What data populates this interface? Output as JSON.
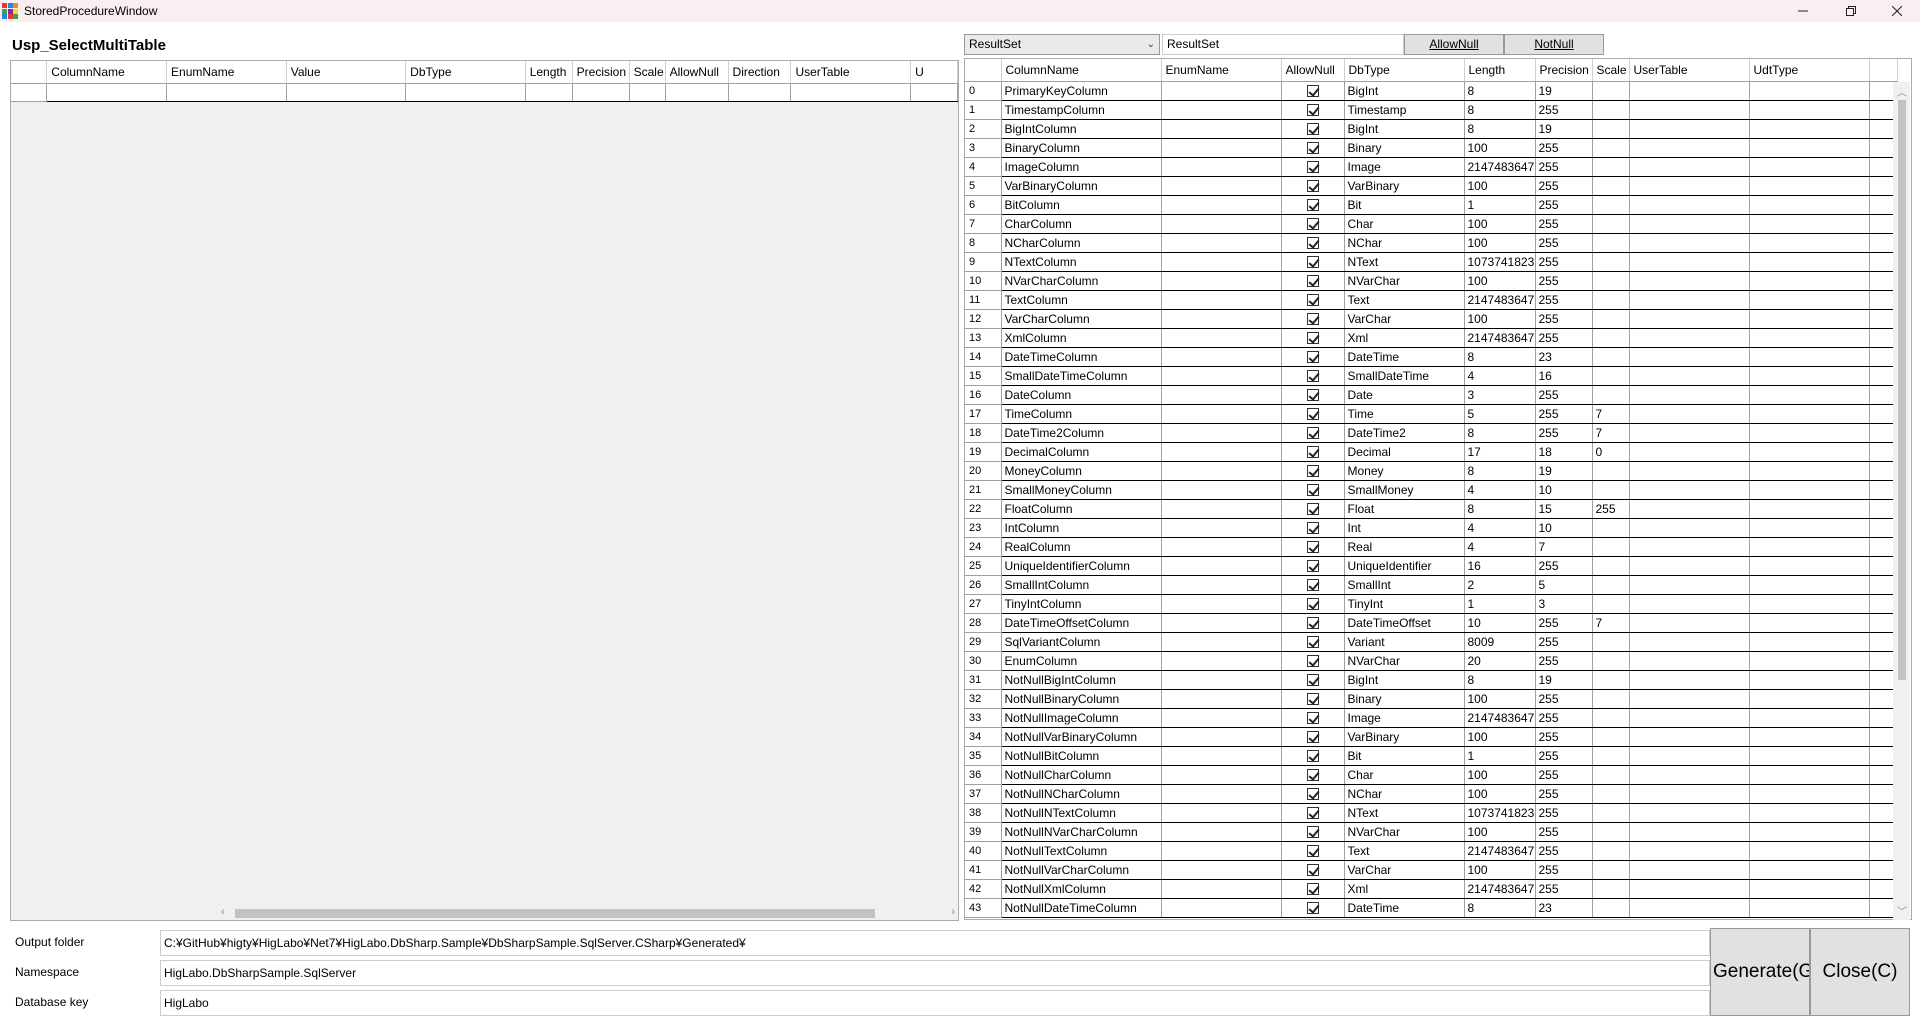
{
  "window": {
    "title": "StoredProcedureWindow",
    "icon": "app-grid-icon",
    "icon_colors": [
      "#e53935",
      "#1e88e5",
      "#fb8c00",
      "#43a047",
      "#8e24aa",
      "#fdd835",
      "#1e88e5",
      "#e53935",
      "#43a047"
    ]
  },
  "procedure_name": "Usp_SelectMultiTable",
  "parameters_grid": {
    "columns": [
      "ColumnName",
      "EnumName",
      "Value",
      "DbType",
      "Length",
      "Precision",
      "Scale",
      "AllowNull",
      "Direction",
      "UserTable",
      "U"
    ],
    "rows": []
  },
  "resultset": {
    "selected": "ResultSet",
    "name": "ResultSet",
    "allow_null_label": "AllowNull",
    "not_null_label": "NotNull"
  },
  "result_grid": {
    "columns": [
      "ColumnName",
      "EnumName",
      "AllowNull",
      "DbType",
      "Length",
      "Precision",
      "Scale",
      "UserTable",
      "UdtType"
    ],
    "rows": [
      {
        "i": "0",
        "name": "PrimaryKeyColumn",
        "type": "BigInt",
        "len": "8",
        "prec": "19",
        "scale": ""
      },
      {
        "i": "1",
        "name": "TimestampColumn",
        "type": "Timestamp",
        "len": "8",
        "prec": "255",
        "scale": ""
      },
      {
        "i": "2",
        "name": "BigIntColumn",
        "type": "BigInt",
        "len": "8",
        "prec": "19",
        "scale": ""
      },
      {
        "i": "3",
        "name": "BinaryColumn",
        "type": "Binary",
        "len": "100",
        "prec": "255",
        "scale": ""
      },
      {
        "i": "4",
        "name": "ImageColumn",
        "type": "Image",
        "len": "2147483647",
        "prec": "255",
        "scale": ""
      },
      {
        "i": "5",
        "name": "VarBinaryColumn",
        "type": "VarBinary",
        "len": "100",
        "prec": "255",
        "scale": ""
      },
      {
        "i": "6",
        "name": "BitColumn",
        "type": "Bit",
        "len": "1",
        "prec": "255",
        "scale": ""
      },
      {
        "i": "7",
        "name": "CharColumn",
        "type": "Char",
        "len": "100",
        "prec": "255",
        "scale": ""
      },
      {
        "i": "8",
        "name": "NCharColumn",
        "type": "NChar",
        "len": "100",
        "prec": "255",
        "scale": ""
      },
      {
        "i": "9",
        "name": "NTextColumn",
        "type": "NText",
        "len": "1073741823",
        "prec": "255",
        "scale": ""
      },
      {
        "i": "10",
        "name": "NVarCharColumn",
        "type": "NVarChar",
        "len": "100",
        "prec": "255",
        "scale": ""
      },
      {
        "i": "11",
        "name": "TextColumn",
        "type": "Text",
        "len": "2147483647",
        "prec": "255",
        "scale": ""
      },
      {
        "i": "12",
        "name": "VarCharColumn",
        "type": "VarChar",
        "len": "100",
        "prec": "255",
        "scale": ""
      },
      {
        "i": "13",
        "name": "XmlColumn",
        "type": "Xml",
        "len": "2147483647",
        "prec": "255",
        "scale": ""
      },
      {
        "i": "14",
        "name": "DateTimeColumn",
        "type": "DateTime",
        "len": "8",
        "prec": "23",
        "scale": ""
      },
      {
        "i": "15",
        "name": "SmallDateTimeColumn",
        "type": "SmallDateTime",
        "len": "4",
        "prec": "16",
        "scale": ""
      },
      {
        "i": "16",
        "name": "DateColumn",
        "type": "Date",
        "len": "3",
        "prec": "255",
        "scale": ""
      },
      {
        "i": "17",
        "name": "TimeColumn",
        "type": "Time",
        "len": "5",
        "prec": "255",
        "scale": "7"
      },
      {
        "i": "18",
        "name": "DateTime2Column",
        "type": "DateTime2",
        "len": "8",
        "prec": "255",
        "scale": "7"
      },
      {
        "i": "19",
        "name": "DecimalColumn",
        "type": "Decimal",
        "len": "17",
        "prec": "18",
        "scale": "0"
      },
      {
        "i": "20",
        "name": "MoneyColumn",
        "type": "Money",
        "len": "8",
        "prec": "19",
        "scale": ""
      },
      {
        "i": "21",
        "name": "SmallMoneyColumn",
        "type": "SmallMoney",
        "len": "4",
        "prec": "10",
        "scale": ""
      },
      {
        "i": "22",
        "name": "FloatColumn",
        "type": "Float",
        "len": "8",
        "prec": "15",
        "scale": "255"
      },
      {
        "i": "23",
        "name": "IntColumn",
        "type": "Int",
        "len": "4",
        "prec": "10",
        "scale": ""
      },
      {
        "i": "24",
        "name": "RealColumn",
        "type": "Real",
        "len": "4",
        "prec": "7",
        "scale": ""
      },
      {
        "i": "25",
        "name": "UniqueIdentifierColumn",
        "type": "UniqueIdentifier",
        "len": "16",
        "prec": "255",
        "scale": ""
      },
      {
        "i": "26",
        "name": "SmallIntColumn",
        "type": "SmallInt",
        "len": "2",
        "prec": "5",
        "scale": ""
      },
      {
        "i": "27",
        "name": "TinyIntColumn",
        "type": "TinyInt",
        "len": "1",
        "prec": "3",
        "scale": ""
      },
      {
        "i": "28",
        "name": "DateTimeOffsetColumn",
        "type": "DateTimeOffset",
        "len": "10",
        "prec": "255",
        "scale": "7"
      },
      {
        "i": "29",
        "name": "SqlVariantColumn",
        "type": "Variant",
        "len": "8009",
        "prec": "255",
        "scale": ""
      },
      {
        "i": "30",
        "name": "EnumColumn",
        "type": "NVarChar",
        "len": "20",
        "prec": "255",
        "scale": ""
      },
      {
        "i": "31",
        "name": "NotNullBigIntColumn",
        "type": "BigInt",
        "len": "8",
        "prec": "19",
        "scale": ""
      },
      {
        "i": "32",
        "name": "NotNullBinaryColumn",
        "type": "Binary",
        "len": "100",
        "prec": "255",
        "scale": ""
      },
      {
        "i": "33",
        "name": "NotNullImageColumn",
        "type": "Image",
        "len": "2147483647",
        "prec": "255",
        "scale": ""
      },
      {
        "i": "34",
        "name": "NotNullVarBinaryColumn",
        "type": "VarBinary",
        "len": "100",
        "prec": "255",
        "scale": ""
      },
      {
        "i": "35",
        "name": "NotNullBitColumn",
        "type": "Bit",
        "len": "1",
        "prec": "255",
        "scale": ""
      },
      {
        "i": "36",
        "name": "NotNullCharColumn",
        "type": "Char",
        "len": "100",
        "prec": "255",
        "scale": ""
      },
      {
        "i": "37",
        "name": "NotNullNCharColumn",
        "type": "NChar",
        "len": "100",
        "prec": "255",
        "scale": ""
      },
      {
        "i": "38",
        "name": "NotNullNTextColumn",
        "type": "NText",
        "len": "1073741823",
        "prec": "255",
        "scale": ""
      },
      {
        "i": "39",
        "name": "NotNullNVarCharColumn",
        "type": "NVarChar",
        "len": "100",
        "prec": "255",
        "scale": ""
      },
      {
        "i": "40",
        "name": "NotNullTextColumn",
        "type": "Text",
        "len": "2147483647",
        "prec": "255",
        "scale": ""
      },
      {
        "i": "41",
        "name": "NotNullVarCharColumn",
        "type": "VarChar",
        "len": "100",
        "prec": "255",
        "scale": ""
      },
      {
        "i": "42",
        "name": "NotNullXmlColumn",
        "type": "Xml",
        "len": "2147483647",
        "prec": "255",
        "scale": ""
      },
      {
        "i": "43",
        "name": "NotNullDateTimeColumn",
        "type": "DateTime",
        "len": "8",
        "prec": "23",
        "scale": ""
      }
    ]
  },
  "form": {
    "output_folder_label": "Output folder",
    "output_folder_value": "C:¥GitHub¥higty¥HigLabo¥Net7¥HigLabo.DbSharp.Sample¥DbSharpSample.SqlServer.CSharp¥Generated¥",
    "namespace_label": "Namespace",
    "namespace_value": "HigLabo.DbSharpSample.SqlServer",
    "database_key_label": "Database key",
    "database_key_value": "HigLabo",
    "generate_label": "Generate(G",
    "close_label": "Close(C)"
  }
}
